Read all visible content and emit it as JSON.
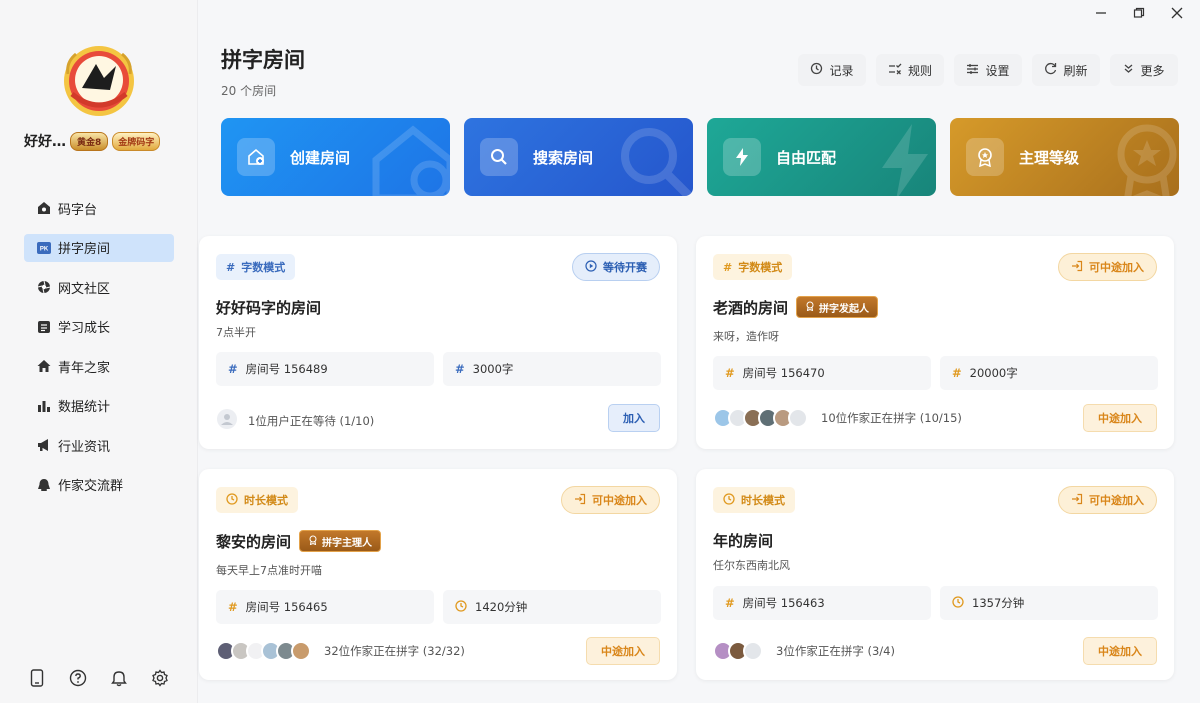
{
  "window": {
    "minimize": "–",
    "maximize": "❐",
    "close": "✕"
  },
  "user": {
    "name": "好好…",
    "level_badge": "黄金8",
    "title_badge": "金牌码字"
  },
  "sidebar": {
    "items": [
      {
        "label": "码字台",
        "icon": "home-icon"
      },
      {
        "label": "拼字房间",
        "icon": "pk-icon",
        "active": true
      },
      {
        "label": "网文社区",
        "icon": "community-icon"
      },
      {
        "label": "学习成长",
        "icon": "book-icon"
      },
      {
        "label": "青年之家",
        "icon": "house-icon"
      },
      {
        "label": "数据统计",
        "icon": "chart-icon"
      },
      {
        "label": "行业资讯",
        "icon": "megaphone-icon"
      },
      {
        "label": "作家交流群",
        "icon": "chat-icon"
      }
    ],
    "bottom_icons": [
      "phone-icon",
      "help-icon",
      "bell-icon",
      "settings-icon"
    ]
  },
  "header": {
    "title": "拼字房间",
    "subtitle": "20 个房间",
    "toolbar": {
      "record": "记录",
      "rules": "规则",
      "settings": "设置",
      "refresh": "刷新",
      "more": "更多"
    }
  },
  "features": {
    "create": "创建房间",
    "search": "搜索房间",
    "match": "自由匹配",
    "level": "主理等级"
  },
  "rooms": [
    {
      "mode": "字数模式",
      "status": "等待开赛",
      "title": "好好码字的房间",
      "desc": "7点半开",
      "room_no": "房间号 156489",
      "target": "3000字",
      "footer": "1位用户正在等待 (1/10)",
      "action": "加入"
    },
    {
      "mode": "字数模式",
      "status": "可中途加入",
      "title": "老酒的房间",
      "role": "拼字发起人",
      "desc": "来呀，造作呀",
      "room_no": "房间号 156470",
      "target": "20000字",
      "footer": "10位作家正在拼字 (10/15)",
      "action": "中途加入"
    },
    {
      "mode": "时长模式",
      "status": "可中途加入",
      "title": "黎安的房间",
      "role": "拼字主理人",
      "desc": "每天早上7点准时开喵",
      "room_no": "房间号 156465",
      "target": "1420分钟",
      "footer": "32位作家正在拼字 (32/32)",
      "action": "中途加入"
    },
    {
      "mode": "时长模式",
      "status": "可中途加入",
      "title": "年的房间",
      "desc": "任尔东西南北风",
      "room_no": "房间号 156463",
      "target": "1357分钟",
      "footer": "3位作家正在拼字 (3/4)",
      "action": "中途加入"
    }
  ],
  "colors": {
    "accent_blue": "#1e74e6",
    "accent_orange": "#d9861a",
    "active_nav": "#cfe3fb"
  }
}
